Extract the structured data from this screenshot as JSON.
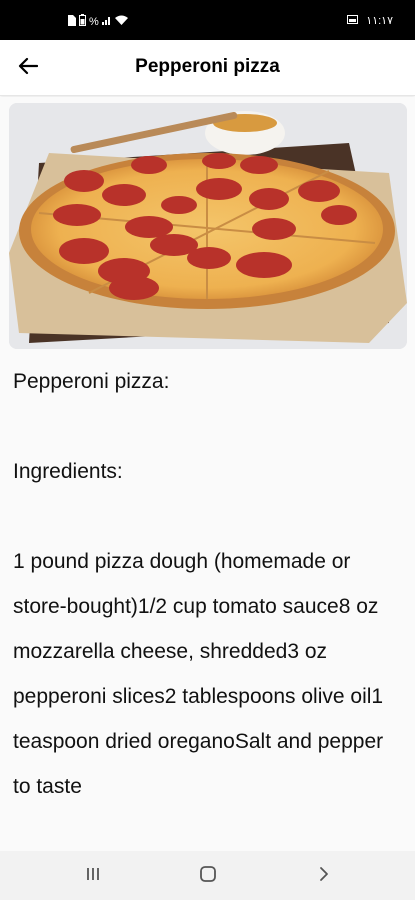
{
  "status_bar": {
    "time": "١١:١٧",
    "battery_level": "%",
    "icons": [
      "sim-icon",
      "battery-icon",
      "network-icon",
      "wifi-icon",
      "screenshot-icon"
    ]
  },
  "app_bar": {
    "title": "Pepperoni pizza",
    "back_icon": "arrow-left-icon"
  },
  "recipe": {
    "image_alt": "pepperoni-pizza-photo",
    "body": "Pepperoni pizza:\n\nIngredients:\n\n1 pound pizza dough (homemade or store-bought)1/2 cup tomato sauce8 oz mozzarella cheese, shredded3 oz pepperoni slices2 tablespoons olive oil1 teaspoon dried oreganoSalt and pepper to taste"
  },
  "nav_bar": {
    "icons": [
      "recents-icon",
      "home-icon",
      "back-chevron-icon"
    ]
  },
  "colors": {
    "status_bar": "#000000",
    "app_bar": "#ffffff",
    "content_bg": "#fafafa",
    "nav_bar": "#f2f2f2"
  }
}
